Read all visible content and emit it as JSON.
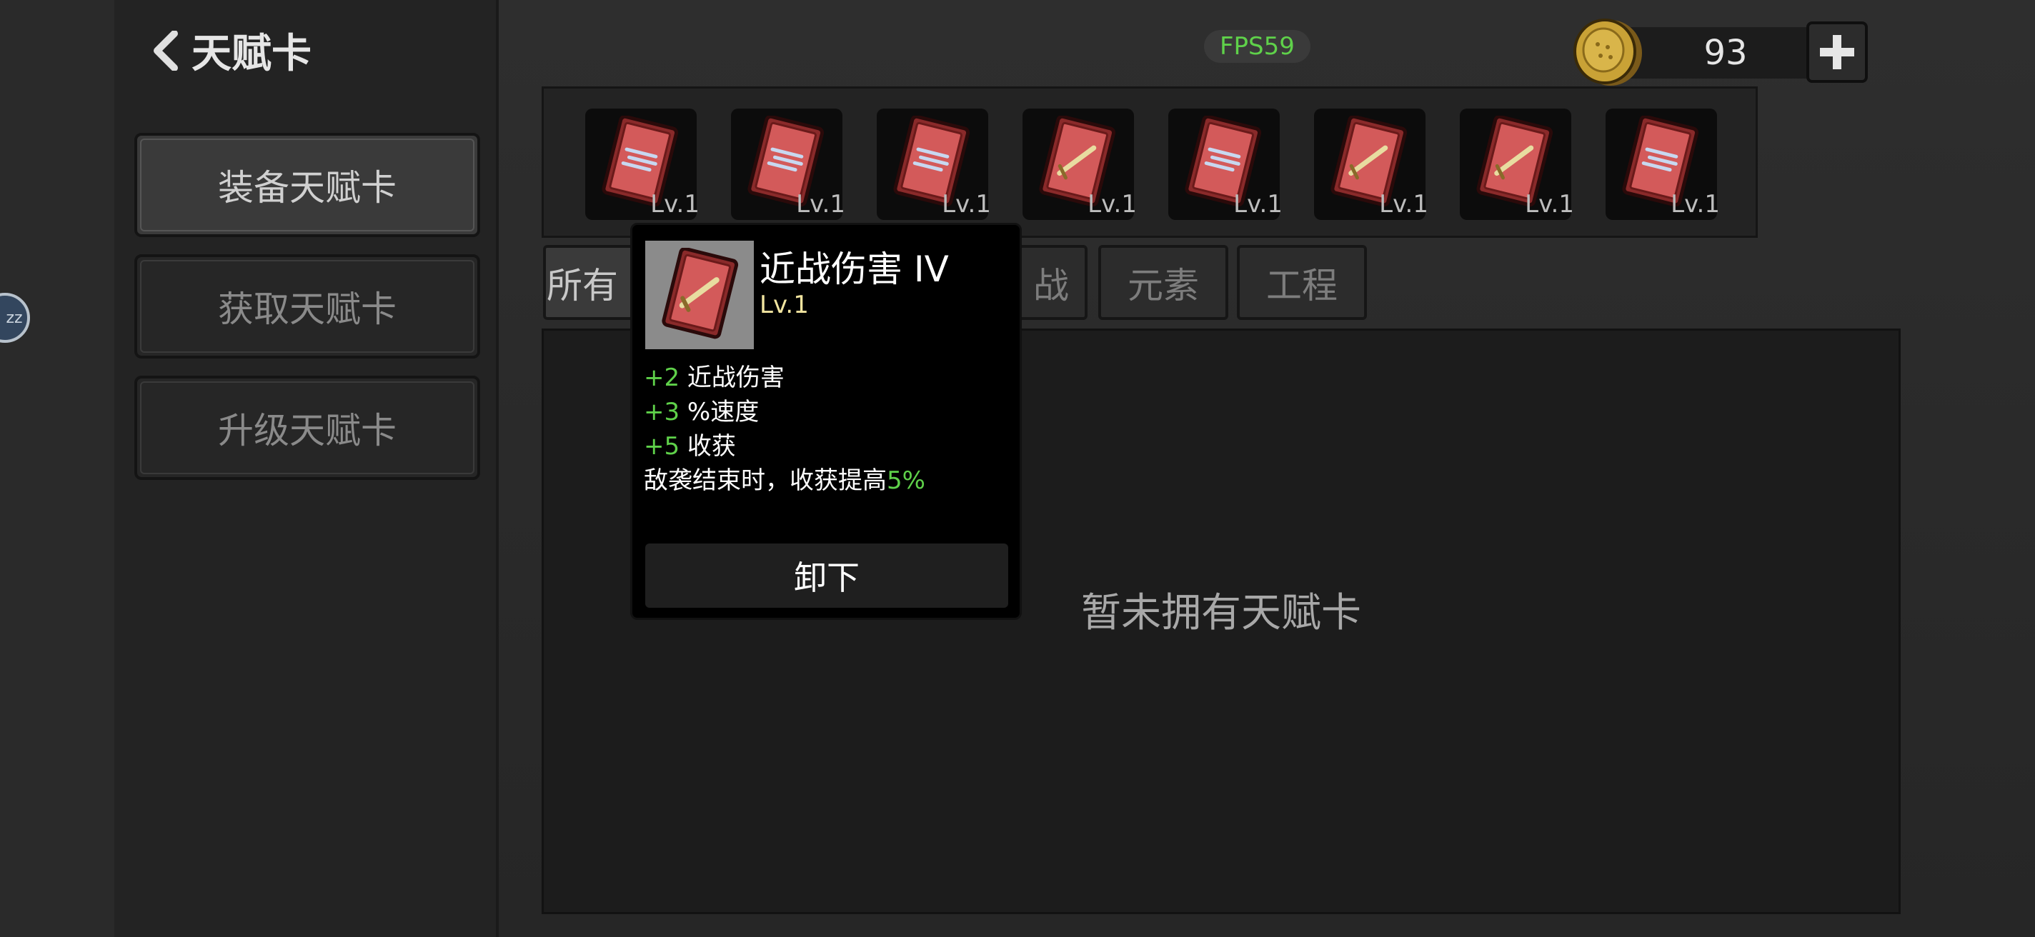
{
  "header": {
    "title": "天赋卡",
    "fps": "FPS59"
  },
  "currency": {
    "amount": "93"
  },
  "sidebar": {
    "items": [
      {
        "label": "装备天赋卡",
        "active": true
      },
      {
        "label": "获取天赋卡",
        "active": false
      },
      {
        "label": "升级天赋卡",
        "active": false
      }
    ]
  },
  "floating_bubble": {
    "text": "zz"
  },
  "equipped": {
    "slots": [
      {
        "level": "Lv.1",
        "icon": "wind-card-icon"
      },
      {
        "level": "Lv.1",
        "icon": "wind-card-icon"
      },
      {
        "level": "Lv.1",
        "icon": "wind-card-icon"
      },
      {
        "level": "Lv.1",
        "icon": "sword-card-icon"
      },
      {
        "level": "Lv.1",
        "icon": "wind-card-icon"
      },
      {
        "level": "Lv.1",
        "icon": "sword-card-icon"
      },
      {
        "level": "Lv.1",
        "icon": "sword-card-icon"
      },
      {
        "level": "Lv.1",
        "icon": "wind-card-icon"
      }
    ]
  },
  "tabs": [
    {
      "label": "所有",
      "active": true
    },
    {
      "label": "战",
      "active": false
    },
    {
      "label": "元素",
      "active": false
    },
    {
      "label": "工程",
      "active": false
    }
  ],
  "content": {
    "empty_message": "暂未拥有天赋卡"
  },
  "popup": {
    "title": "近战伤害 IV",
    "level": "Lv.1",
    "stats": [
      {
        "value": "+2",
        "label": " 近战伤害"
      },
      {
        "value": "+3",
        "label": " %速度"
      },
      {
        "value": "+5",
        "label": " 收获"
      }
    ],
    "effect_text": "敌袭结束时，收获提高",
    "effect_value": "5%",
    "unequip_label": "卸下"
  },
  "colors": {
    "accent_green": "#5fd14a",
    "card_red": "#c94a4a",
    "level_yellow": "#f2e5a0"
  }
}
